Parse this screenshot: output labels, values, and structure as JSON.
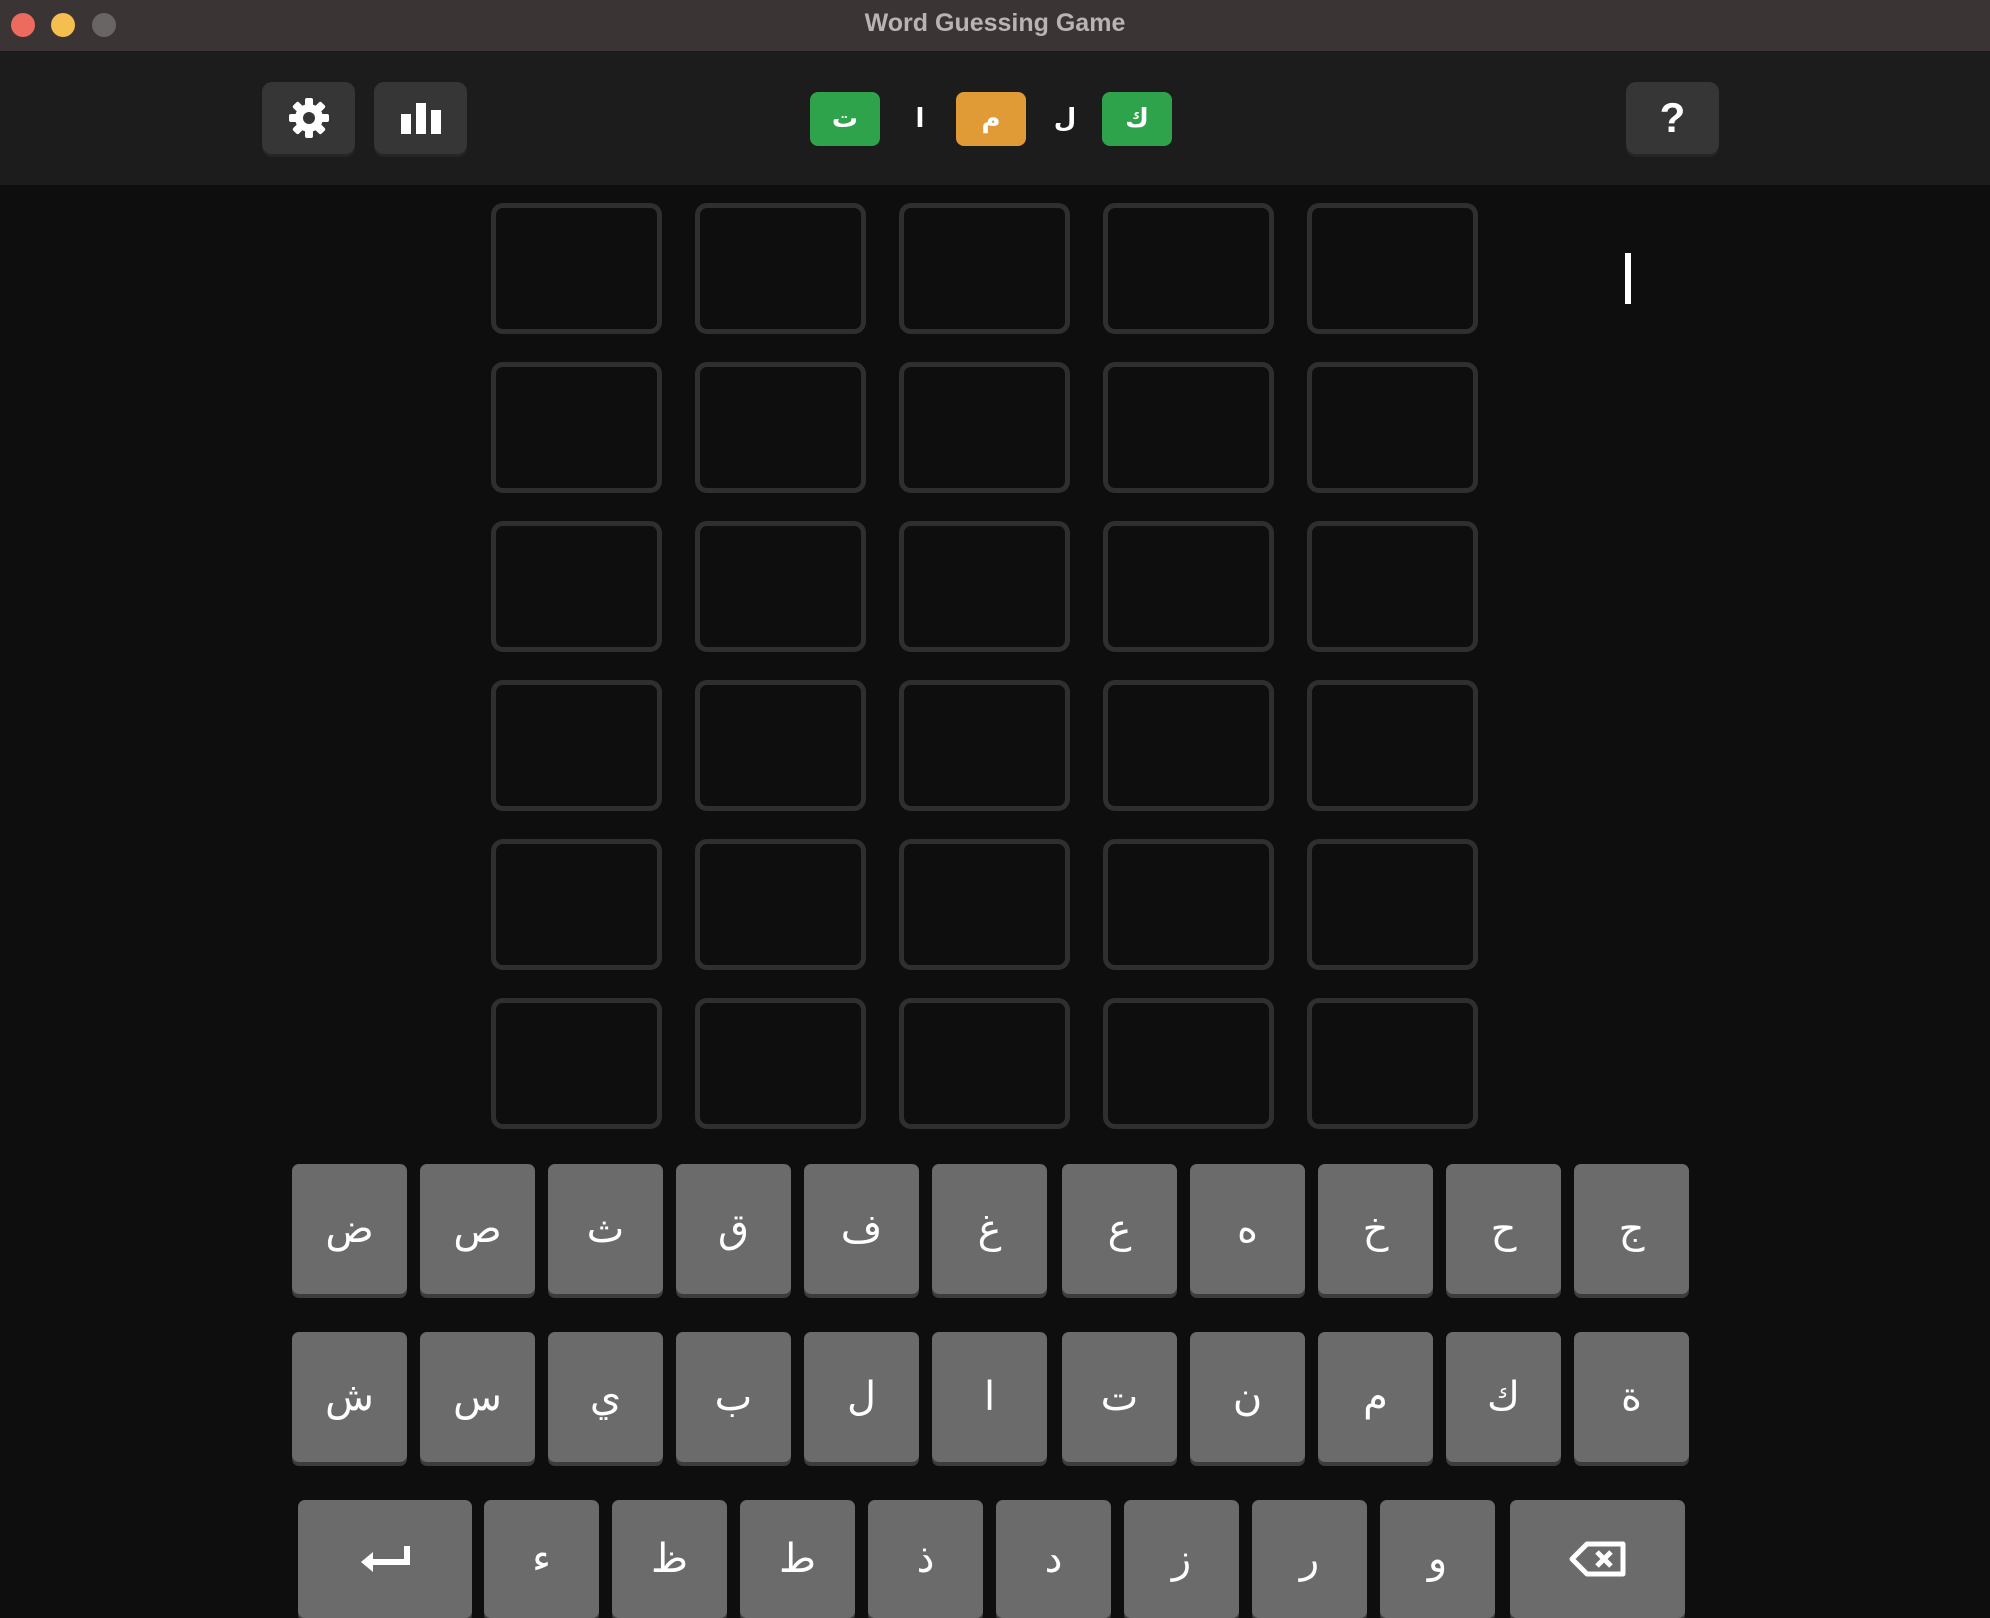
{
  "window": {
    "title": "Word Guessing Game"
  },
  "toolbar": {
    "settings_icon": "gear-icon",
    "stats_icon": "bar-chart-icon",
    "help_label": "?",
    "hint_letters": [
      {
        "letter": "ت",
        "state": "correct"
      },
      {
        "letter": "ا",
        "state": "plain"
      },
      {
        "letter": "م",
        "state": "present"
      },
      {
        "letter": "ل",
        "state": "plain"
      },
      {
        "letter": "ك",
        "state": "correct"
      }
    ]
  },
  "colors": {
    "correct": "#2fa24c",
    "present": "#e09b37",
    "key": "#6b6b6b",
    "cell_border": "#2f2f2f",
    "background": "#0e0e0e"
  },
  "board": {
    "rows": [
      [
        "",
        "",
        "",
        "",
        ""
      ],
      [
        "",
        "",
        "",
        "",
        ""
      ],
      [
        "",
        "",
        "",
        "",
        ""
      ],
      [
        "",
        "",
        "",
        "",
        ""
      ],
      [
        "",
        "",
        "",
        "",
        ""
      ],
      [
        "",
        "",
        "",
        "",
        ""
      ]
    ]
  },
  "keyboard": {
    "row1": [
      "ض",
      "ص",
      "ث",
      "ق",
      "ف",
      "غ",
      "ع",
      "ه",
      "خ",
      "ح",
      "ج"
    ],
    "row2": [
      "ش",
      "س",
      "ي",
      "ب",
      "ل",
      "ا",
      "ت",
      "ن",
      "م",
      "ك",
      "ة"
    ],
    "row3": [
      "ء",
      "ظ",
      "ط",
      "ذ",
      "د",
      "ز",
      "ر",
      "و"
    ],
    "enter_icon": "enter-arrow-icon",
    "backspace_icon": "backspace-icon"
  }
}
